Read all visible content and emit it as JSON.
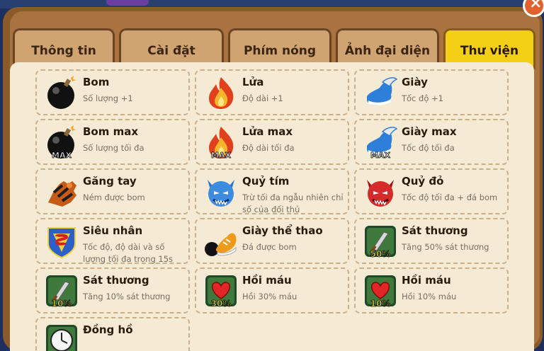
{
  "tabs": [
    {
      "label": "Thông tin"
    },
    {
      "label": "Cài đặt"
    },
    {
      "label": "Phím nóng"
    },
    {
      "label": "Ảnh đại diện"
    },
    {
      "label": "Thư viện"
    }
  ],
  "active_tab": "Thư viện",
  "items": [
    {
      "name": "Bom",
      "desc": "Số lượng +1",
      "icon": "bomb-icon"
    },
    {
      "name": "Lửa",
      "desc": "Độ dài +1",
      "icon": "fire-icon"
    },
    {
      "name": "Giày",
      "desc": "Tốc độ +1",
      "icon": "shoe-icon"
    },
    {
      "name": "Bom max",
      "desc": "Số lượng tối đa",
      "icon": "bomb-max-icon",
      "badge": "MAX"
    },
    {
      "name": "Lửa max",
      "desc": "Độ dài tối đa",
      "icon": "fire-max-icon",
      "badge": "MAX"
    },
    {
      "name": "Giày max",
      "desc": "Tốc độ tối đa",
      "icon": "shoe-max-icon",
      "badge": "MAX"
    },
    {
      "name": "Găng tay",
      "desc": "Ném được bom",
      "icon": "glove-icon"
    },
    {
      "name": "Quỷ tím",
      "desc": "Trừ tối đa ngẫu nhiên chỉ số của đối thủ",
      "icon": "purple-devil-icon"
    },
    {
      "name": "Quỷ đỏ",
      "desc": "Tốc độ tối đa + đá bom",
      "icon": "red-devil-icon"
    },
    {
      "name": "Siêu nhân",
      "desc": "Tốc độ, độ dài và số lượng tối đa trong 15s",
      "icon": "superman-shield-icon"
    },
    {
      "name": "Giày thể thao",
      "desc": "Đá được bom",
      "icon": "sneaker-icon"
    },
    {
      "name": "Sát thương",
      "desc": "Tăng 50% sát thương",
      "icon": "sword-icon",
      "badge": "50%"
    },
    {
      "name": "Sát thương",
      "desc": "Tăng 10% sát thương",
      "icon": "sword-icon",
      "badge": "10%"
    },
    {
      "name": "Hồi máu",
      "desc": "Hồi 30% máu",
      "icon": "heart-icon",
      "badge": "30%"
    },
    {
      "name": "Hồi máu",
      "desc": "Hồi 10% máu",
      "icon": "heart-icon",
      "badge": "10%"
    },
    {
      "name": "Đồng hồ",
      "desc": "",
      "icon": "clock-icon"
    }
  ],
  "colors": {
    "active_tab": "#f3cf16",
    "tab": "#cfa471",
    "panel": "#f5ebd4",
    "frame": "#8b5a2b"
  }
}
